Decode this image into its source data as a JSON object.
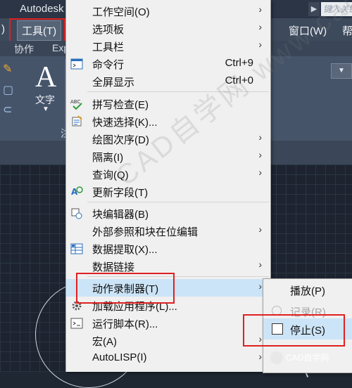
{
  "titlebar": {
    "app_title": "Autodesk",
    "search_placeholder": "键入关键"
  },
  "menubar": {
    "left_fragment": ")",
    "tools": "工具(T)",
    "window": "窗口(W)",
    "right_fragment": "帮"
  },
  "tabs": {
    "collab": "协作",
    "exp": "Exp"
  },
  "ribbon": {
    "text_big": "A",
    "text_label": "文字",
    "left_fragment": "注"
  },
  "tools_menu": {
    "items": [
      {
        "label": "工作空间(O)",
        "shortcut": "",
        "submenu": true
      },
      {
        "label": "选项板",
        "shortcut": "",
        "submenu": true
      },
      {
        "label": "工具栏",
        "shortcut": "",
        "submenu": true
      },
      {
        "label": "命令行",
        "shortcut": "Ctrl+9",
        "submenu": false
      },
      {
        "label": "全屏显示",
        "shortcut": "Ctrl+0",
        "submenu": false
      },
      {
        "label": "拼写检查(E)",
        "shortcut": "",
        "submenu": false
      },
      {
        "label": "快速选择(K)...",
        "shortcut": "",
        "submenu": false
      },
      {
        "label": "绘图次序(D)",
        "shortcut": "",
        "submenu": true
      },
      {
        "label": "隔离(I)",
        "shortcut": "",
        "submenu": true
      },
      {
        "label": "查询(Q)",
        "shortcut": "",
        "submenu": true
      },
      {
        "label": "更新字段(T)",
        "shortcut": "",
        "submenu": false
      },
      {
        "label": "块编辑器(B)",
        "shortcut": "",
        "submenu": false
      },
      {
        "label": "外部参照和块在位编辑",
        "shortcut": "",
        "submenu": true
      },
      {
        "label": "数据提取(X)...",
        "shortcut": "",
        "submenu": false
      },
      {
        "label": "数据链接",
        "shortcut": "",
        "submenu": true
      },
      {
        "label": "动作录制器(T)",
        "shortcut": "",
        "submenu": true
      },
      {
        "label": "加载应用程序(L)...",
        "shortcut": "",
        "submenu": false
      },
      {
        "label": "运行脚本(R)...",
        "shortcut": "",
        "submenu": false
      },
      {
        "label": "宏(A)",
        "shortcut": "",
        "submenu": true
      },
      {
        "label": "AutoLISP(I)",
        "shortcut": "",
        "submenu": true
      }
    ],
    "spell_icon_text": "ABC"
  },
  "recorder_submenu": {
    "play": "播放(P)",
    "record": "记录(R)",
    "stop": "停止(S)"
  },
  "colors": {
    "menu_bg": "#f0f0f0",
    "highlight": "#cce4f7",
    "annotation_red": "#e02020",
    "menubar_bg": "#3d4a5c"
  },
  "watermark": {
    "text": "CAD自学网 www.cadzxw.com",
    "badge": "CAD自学网"
  }
}
